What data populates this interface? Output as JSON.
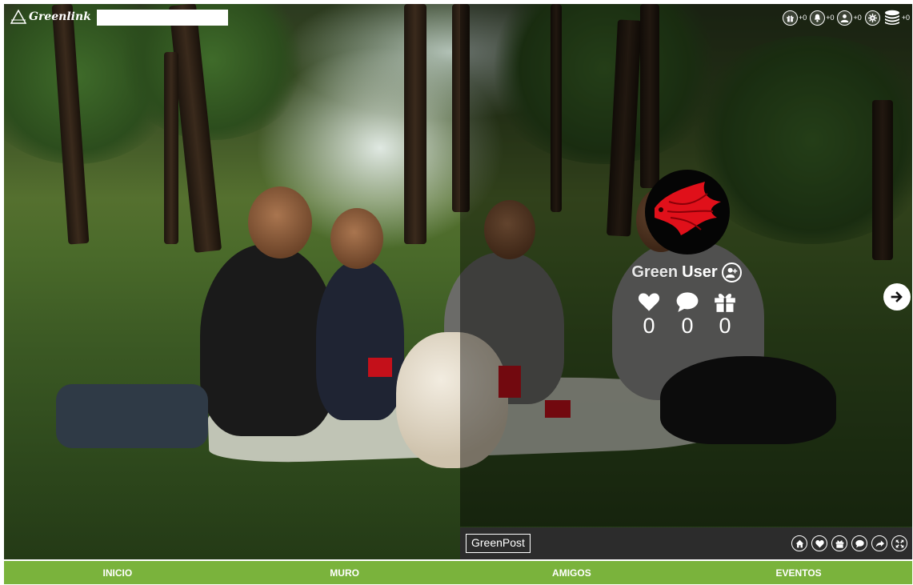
{
  "header": {
    "logo_text": "Greenlink",
    "search": {
      "value": "",
      "placeholder": ""
    },
    "icons": [
      {
        "name": "gift-icon",
        "count": "+0"
      },
      {
        "name": "bell-icon",
        "count": "+0"
      },
      {
        "name": "user-icon",
        "count": "+0"
      },
      {
        "name": "gear-icon",
        "count": ""
      },
      {
        "name": "coins-icon",
        "count": "+0"
      }
    ]
  },
  "profile": {
    "name_first": "Green",
    "name_last": "User",
    "stats": {
      "likes": "0",
      "comments": "0",
      "gifts": "0"
    }
  },
  "post_bar": {
    "label": "GreenPost",
    "actions": [
      "home-icon",
      "heart-icon",
      "gift-icon",
      "comment-icon",
      "share-icon",
      "fullscreen-icon"
    ]
  },
  "nav": {
    "items": [
      "INICIO",
      "MURO",
      "AMIGOS",
      "EVENTOS"
    ]
  },
  "colors": {
    "nav_bg": "#7ab33c",
    "post_bar_bg": "#2c2c2c",
    "avatar_fish": "#e0101a"
  }
}
